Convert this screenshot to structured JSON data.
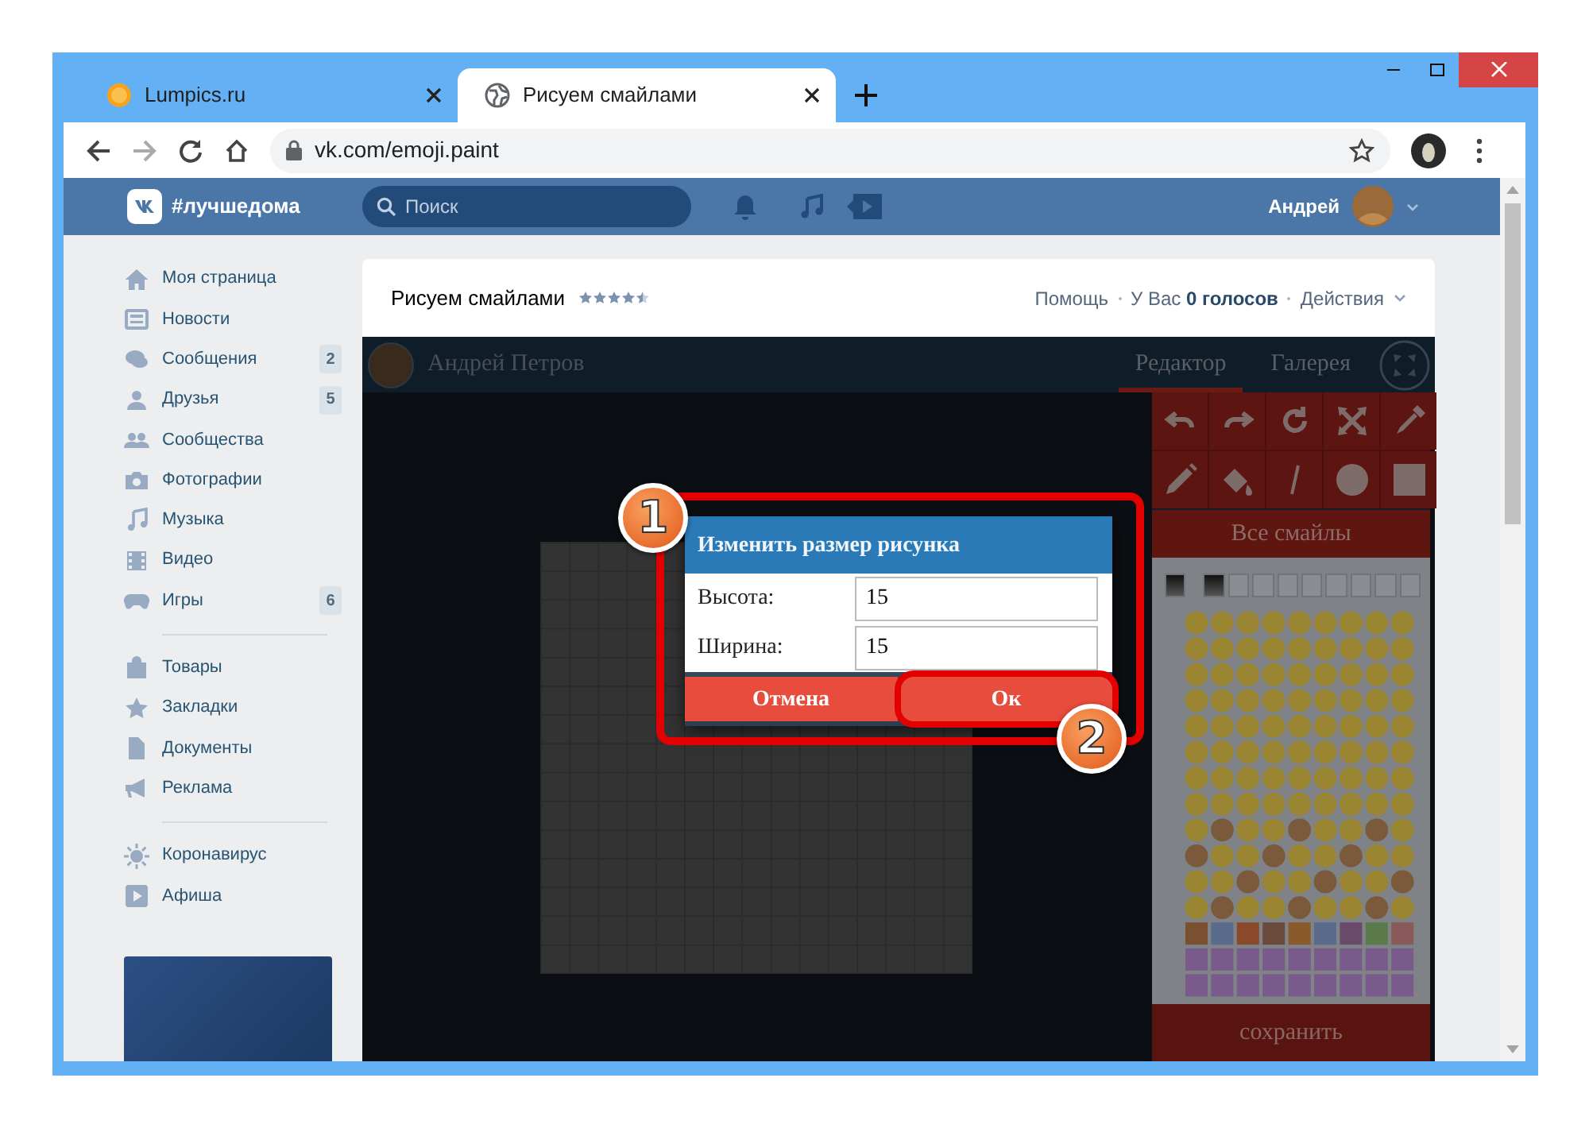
{
  "browser": {
    "tabs": [
      {
        "title": "Lumpics.ru",
        "selected": false
      },
      {
        "title": "Рисуем смайлами",
        "selected": true
      }
    ],
    "url": "vk.com/emoji.paint"
  },
  "vk_header": {
    "logo_text": "#лучшедома",
    "search": {
      "placeholder": "Поиск"
    },
    "user_name": "Андрей"
  },
  "sidebar": {
    "groups": [
      [
        {
          "label": "Моя страница"
        },
        {
          "label": "Новости"
        },
        {
          "label": "Сообщения",
          "count": "2"
        },
        {
          "label": "Друзья",
          "count": "5"
        },
        {
          "label": "Сообщества"
        },
        {
          "label": "Фотографии"
        },
        {
          "label": "Музыка"
        },
        {
          "label": "Видео"
        },
        {
          "label": "Игры",
          "count": "6"
        }
      ],
      [
        {
          "label": "Товары"
        },
        {
          "label": "Закладки"
        },
        {
          "label": "Документы"
        },
        {
          "label": "Реклама"
        }
      ],
      [
        {
          "label": "Коронавирус"
        },
        {
          "label": "Афиша"
        }
      ]
    ]
  },
  "app": {
    "title": "Рисуем смайлами",
    "stars": 4.5,
    "links": [
      {
        "text": "Помощь"
      },
      {
        "text": "У Вас **0 голосов**"
      },
      {
        "text": "Действия"
      }
    ]
  },
  "editor": {
    "author": "Андрей Петров",
    "tabs": [
      {
        "label": "Редактор",
        "selected": true
      },
      {
        "label": "Галерея",
        "selected": false
      }
    ],
    "all_emoji_button": "Все смайлы",
    "save_button": "сохранить"
  },
  "dialog": {
    "title": "Изменить размер рисунка",
    "fields": [
      {
        "label": "Высота:",
        "value": "15"
      },
      {
        "label": "Ширина:",
        "value": "15"
      }
    ],
    "buttons": [
      {
        "label": "Отмена",
        "highlighted": false
      },
      {
        "label": "Ок",
        "highlighted": true
      }
    ]
  },
  "annotations": [
    {
      "label": "1"
    },
    {
      "label": "2"
    }
  ]
}
